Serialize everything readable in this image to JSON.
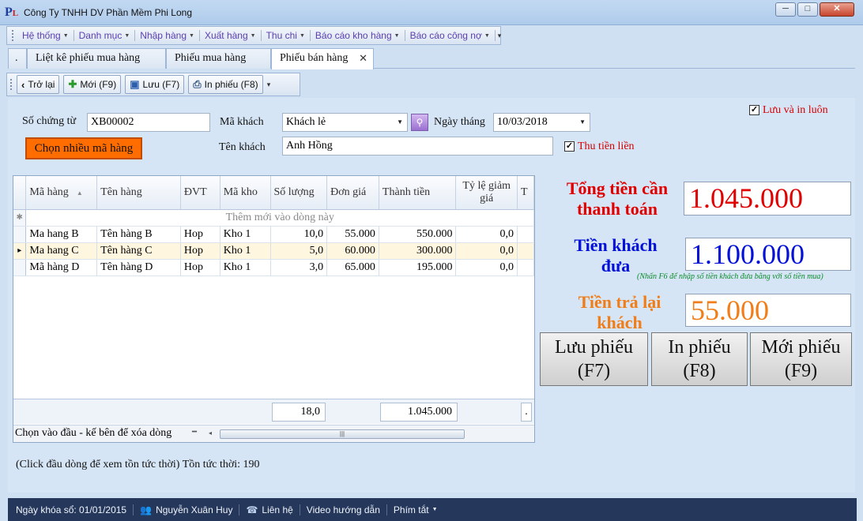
{
  "window": {
    "title": "Công Ty TNHH DV Phần Mềm Phi Long",
    "minimize": "─",
    "maximize": "□",
    "close": "✕"
  },
  "menu": [
    {
      "label": "Hệ thống"
    },
    {
      "label": "Danh mục"
    },
    {
      "label": "Nhập hàng"
    },
    {
      "label": "Xuất hàng"
    },
    {
      "label": "Thu chi"
    },
    {
      "label": "Báo cáo kho hàng"
    },
    {
      "label": "Báo cáo công nợ"
    }
  ],
  "tabs": [
    {
      "label": "."
    },
    {
      "label": "Liệt kê phiếu mua hàng"
    },
    {
      "label": "Phiếu mua hàng"
    },
    {
      "label": "Phiếu bán hàng"
    }
  ],
  "toolbar": {
    "back": "Trở lại",
    "new": "Mới (F9)",
    "save": "Lưu (F7)",
    "print": "In phiếu (F8)"
  },
  "form": {
    "voucher_label": "Số chứng từ",
    "voucher_value": "XB00002",
    "customer_code_label": "Mã khách",
    "customer_code_value": "Khách lẻ",
    "date_label": "Ngày tháng",
    "date_value": "10/03/2018",
    "customer_name_label": "Tên khách",
    "customer_name_value": "Anh Hồng",
    "multi_select_button": "Chọn nhiều mã hàng",
    "save_and_print_label": "Lưu và in luôn",
    "collect_money_label": "Thu tiền liền"
  },
  "grid": {
    "columns": [
      "Mã hàng",
      "Tên hàng",
      "ĐVT",
      "Mã kho",
      "Số lượng",
      "Đơn giá",
      "Thành tiền",
      "Tỷ lệ giảm giá",
      "T"
    ],
    "new_row_text": "Thêm mới vào dòng này",
    "rows": [
      {
        "code": "Ma hang B",
        "name": "Tên hàng B",
        "unit": "Hop",
        "warehouse": "Kho 1",
        "qty": "10,0",
        "price": "55.000",
        "amount": "550.000",
        "discount": "0,0"
      },
      {
        "code": "Ma hang C",
        "name": "Tên hàng C",
        "unit": "Hop",
        "warehouse": "Kho 1",
        "qty": "5,0",
        "price": "60.000",
        "amount": "300.000",
        "discount": "0,0"
      },
      {
        "code": "Mã hàng D",
        "name": "Tên hàng D",
        "unit": "Hop",
        "warehouse": "Kho 1",
        "qty": "3,0",
        "price": "65.000",
        "amount": "195.000",
        "discount": "0,0"
      }
    ],
    "total_qty": "18,0",
    "total_amount": "1.045.000",
    "delete_hint": "Chọn vào đầu - kế bên để xóa dòng"
  },
  "summary": {
    "total_label": "Tổng tiền cần thanh toán",
    "total_value": "1.045.000",
    "paid_label": "Tiền khách đưa",
    "paid_value": "1.100.000",
    "paid_note": "(Nhấn F6 để nhập số tiền khách đưa bằng với số tiền mua)",
    "change_label": "Tiền trả lại khách",
    "change_value": "55.000",
    "colors": {
      "total": "#e00000",
      "paid": "#0010d8",
      "change": "#f07d17"
    }
  },
  "actions": {
    "save": "Lưu phiếu (F7)",
    "print": "In phiếu (F8)",
    "new": "Mới phiếu (F9)"
  },
  "stock_hint": "(Click đầu dòng để xem tồn tức thời) Tồn tức thời:  190",
  "status": {
    "lock_date": "Ngày khóa sổ: 01/01/2015",
    "user": "Nguyễn Xuân Huy",
    "contact": "Liên hệ",
    "video": "Video hướng dẫn",
    "shortcuts": "Phím tắt"
  }
}
